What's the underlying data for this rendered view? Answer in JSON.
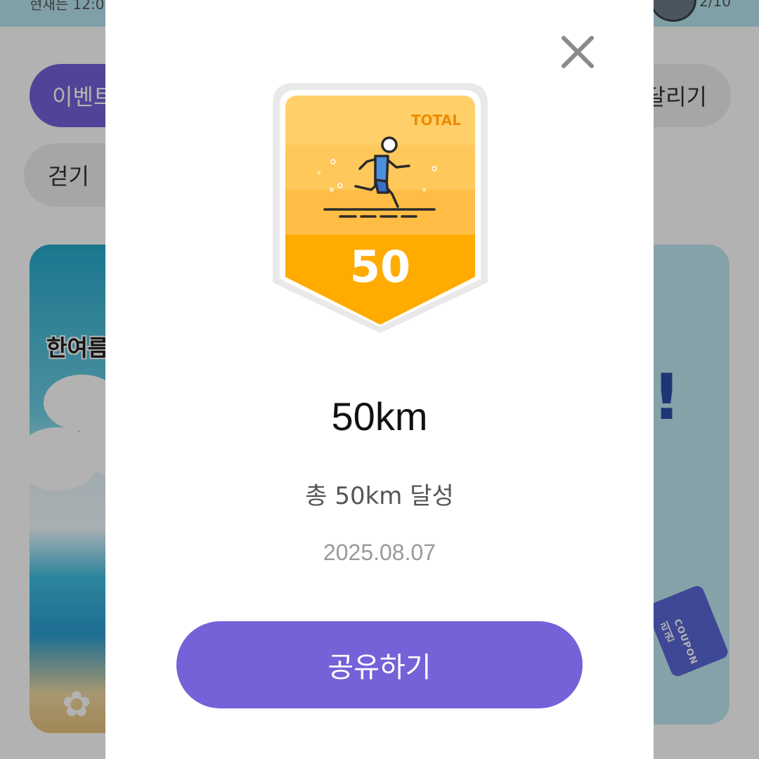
{
  "background": {
    "top_strip_text": "현재는 12:0",
    "top_strip_right_text": "2/10",
    "chips": {
      "event": "이벤트",
      "running": "달리기",
      "walk": "걷기"
    },
    "banner_left_text": "한여름",
    "banner_right_glyph": "!",
    "coupon_label": "COUPON",
    "coupon_side_text": "리권"
  },
  "modal": {
    "badge": {
      "label": "TOTAL",
      "number": "50",
      "icon": "runner-icon",
      "colors": {
        "top": "#ffd36e",
        "bottom": "#ffab00",
        "label": "#f08a00",
        "frame": "#e9e9e9"
      }
    },
    "title": "50km",
    "description": "총 50km 달성",
    "date": "2025.08.07",
    "share_button_label": "공유하기",
    "close_icon": "close-icon",
    "colors": {
      "accent": "#7561d8"
    }
  }
}
